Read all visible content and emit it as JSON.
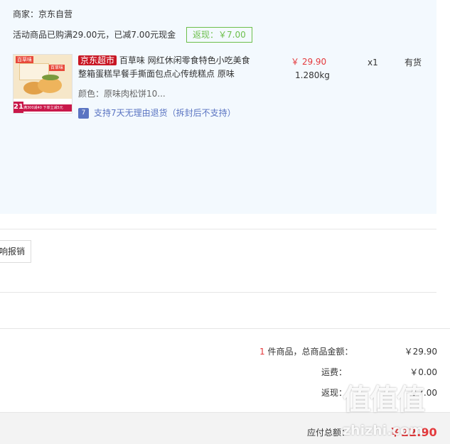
{
  "shop": {
    "label": "商家：京东自营",
    "promo_text": "活动商品已购满29.00元，已减7.00元现金",
    "rebate_tag": "返现：￥7.00"
  },
  "product": {
    "badge": "京东超市",
    "title": "百草味 网红休闲零食特色小吃美食整箱蛋糕早餐手撕面包点心传统糕点 原味",
    "price": "￥ 29.90",
    "weight": "1.280kg",
    "quantity": "x1",
    "stock": "有货",
    "color": "颜色：原味肉松饼10...",
    "return_policy": "支持7天无理由退货（拆封后不支持）",
    "return_icon_glyph": "7",
    "thumb": {
      "brand": "百草味",
      "brand2": "百草味",
      "promo_big": "21",
      "promo_strip": "满300减40 下单立减5元"
    }
  },
  "actions": {
    "partial_button": "影响报销"
  },
  "summary": {
    "count_num": "1",
    "count_text": " 件商品，总商品金额：",
    "total_value": "￥29.90",
    "shipping_label": "运费：",
    "shipping_value": "￥0.00",
    "rebate_label": "返现：",
    "rebate_value": "-￥7.00",
    "payable_label": "应付总额：",
    "payable_value": "￥22.90"
  },
  "watermark": {
    "logo": "值值值",
    "domain": "zhizhi.com"
  },
  "colors": {
    "accent_red": "#e4393c",
    "panel_bg": "#f3f9fe",
    "green": "#6cbf4b",
    "badge_red": "#c81623"
  }
}
